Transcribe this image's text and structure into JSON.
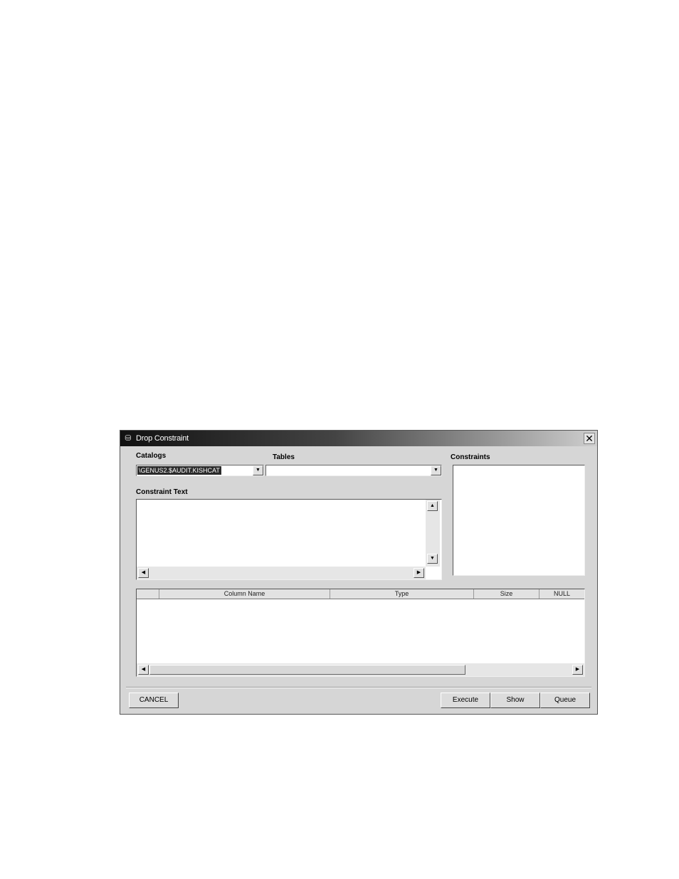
{
  "window": {
    "title": "Drop Constraint",
    "close_glyph": "✕"
  },
  "catalogs": {
    "label": "Catalogs",
    "selected": "\\GENUS2.$AUDIT.KISHCAT"
  },
  "tables": {
    "label": "Tables",
    "selected": ""
  },
  "constraints": {
    "label": "Constraints"
  },
  "constraint_text": {
    "label": "Constraint Text",
    "value": ""
  },
  "columns_grid": {
    "headers": [
      "Column Name",
      "Type",
      "Size",
      "NULL"
    ]
  },
  "buttons": {
    "cancel": "CANCEL",
    "execute": "Execute",
    "show": "Show",
    "queue": "Queue"
  },
  "icons": {
    "app": "database-app-icon",
    "close": "close-icon",
    "dropdown": "chevron-down-icon",
    "scroll_up": "arrow-up-icon",
    "scroll_down": "arrow-down-icon",
    "scroll_left": "arrow-left-icon",
    "scroll_right": "arrow-right-icon"
  }
}
